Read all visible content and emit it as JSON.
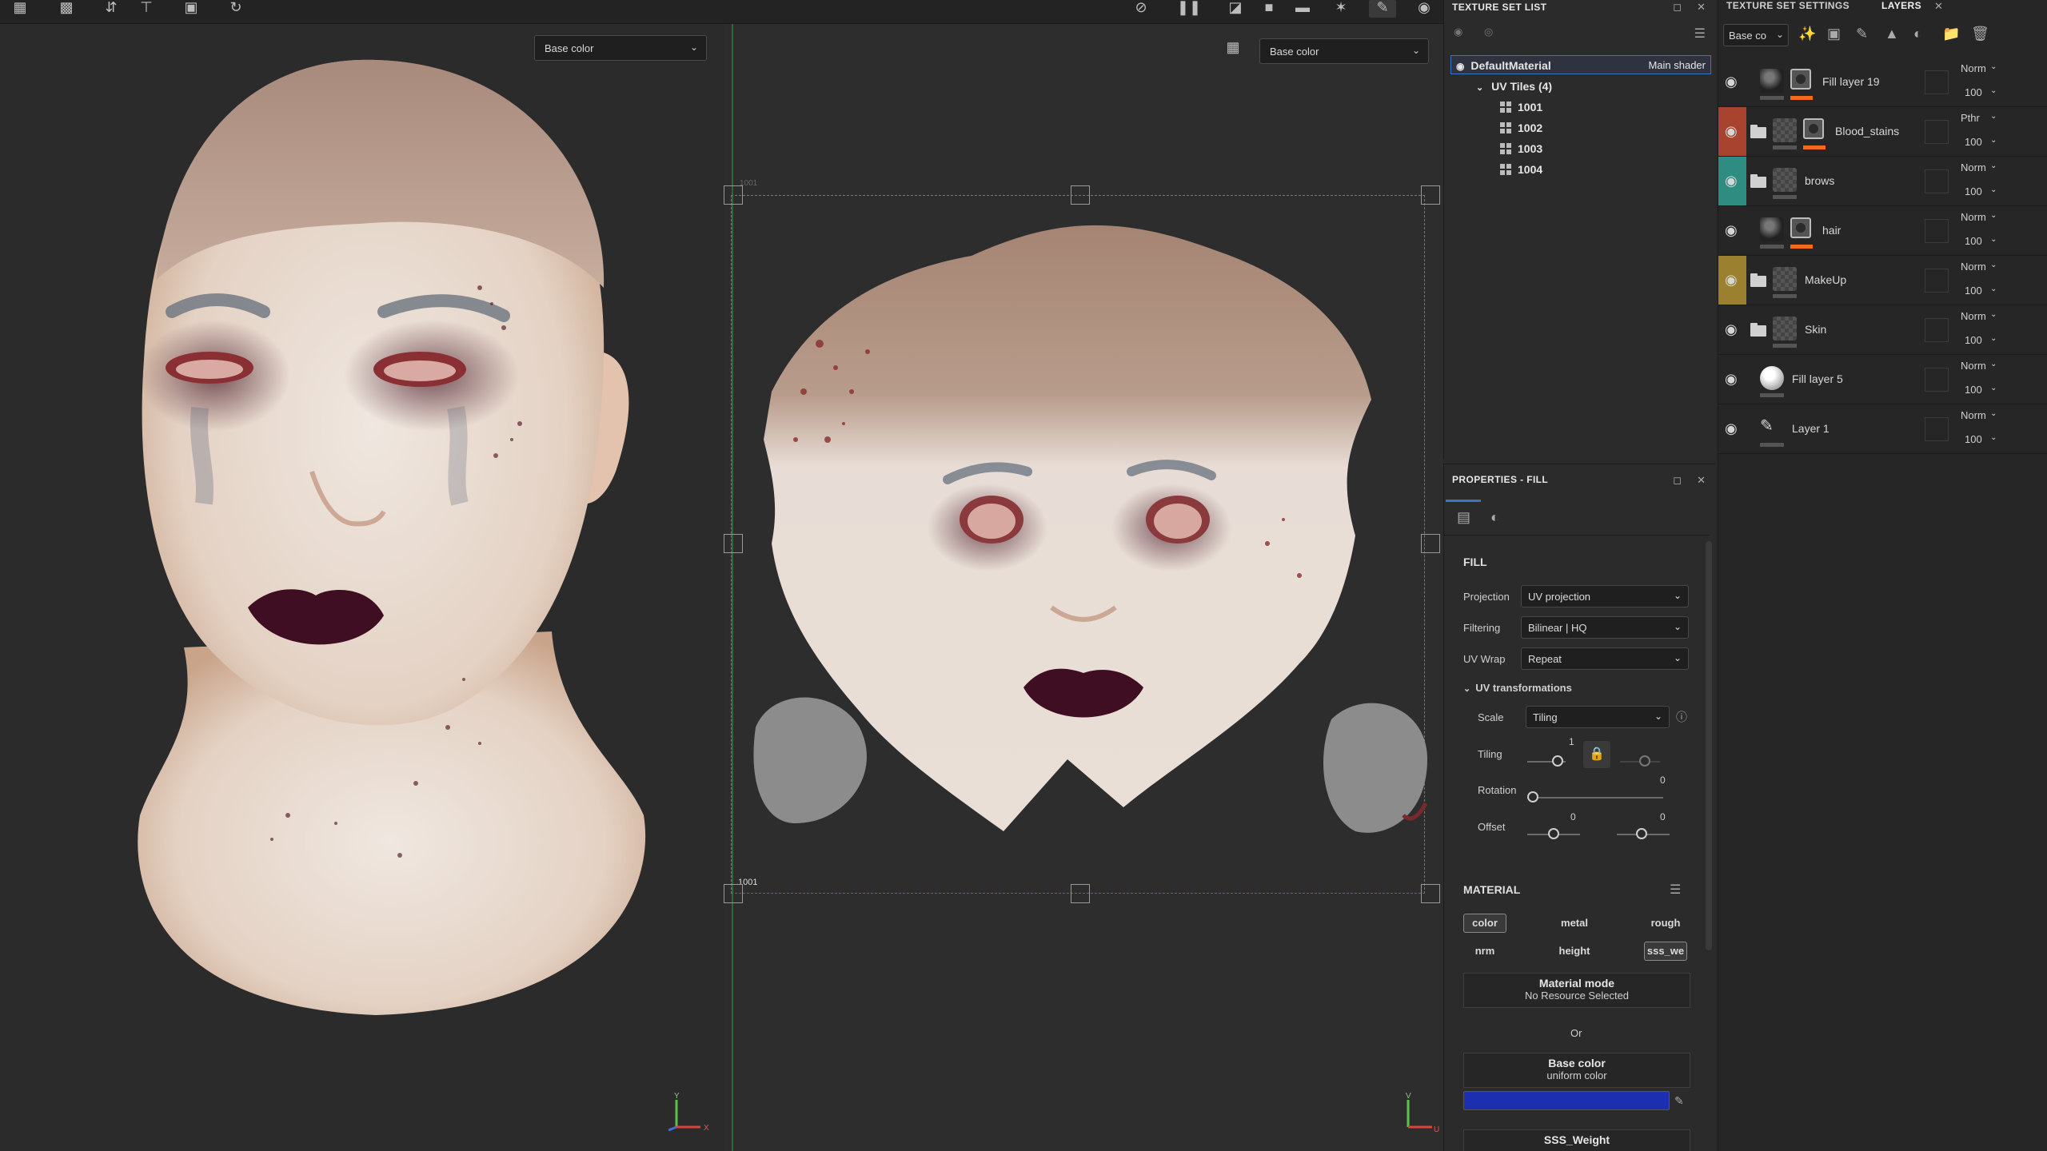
{
  "viewports": {
    "left_channel_select": "Base color",
    "right_channel_select": "Base color",
    "uv_tile_tag_top": "1001",
    "uv_tile_tag_bottom": "1001",
    "axis_y": "Y",
    "axis_x": "X",
    "axis_v": "V",
    "axis_u": "U"
  },
  "texture_set_list": {
    "title": "TEXTURE SET LIST",
    "material_name": "DefaultMaterial",
    "shader": "Main shader",
    "uv_tiles_label": "UV Tiles (4)",
    "tiles": [
      "1001",
      "1002",
      "1003",
      "1004"
    ]
  },
  "properties": {
    "title": "PROPERTIES - FILL",
    "fill_title": "FILL",
    "projection_label": "Projection",
    "projection_value": "UV projection",
    "filtering_label": "Filtering",
    "filtering_value": "Bilinear | HQ",
    "uvwrap_label": "UV Wrap",
    "uvwrap_value": "Repeat",
    "uvtrans_label": "UV transformations",
    "scale_label": "Scale",
    "scale_value": "Tiling",
    "tiling_label": "Tiling",
    "tiling_value": "1",
    "rotation_label": "Rotation",
    "rotation_value": "0",
    "offset_label": "Offset",
    "offset_u": "0",
    "offset_v": "0",
    "material_title": "MATERIAL",
    "channels": [
      "color",
      "metal",
      "rough",
      "nrm",
      "height",
      "sss_we"
    ],
    "material_mode_title": "Material mode",
    "material_mode_value": "No Resource Selected",
    "or_label": "Or",
    "base_color_title": "Base color",
    "base_color_sub": "uniform color",
    "base_color_hex": "#1c2fb0",
    "sss_title": "SSS_Weight"
  },
  "layers_panel": {
    "tab_settings": "TEXTURE SET SETTINGS",
    "tab_layers": "LAYERS",
    "channel_select": "Base co",
    "layers": [
      {
        "name": "Fill layer 19",
        "blend": "Norm",
        "opacity": "100",
        "color": ""
      },
      {
        "name": "Blood_stains",
        "blend": "Pthr",
        "opacity": "100",
        "color": "#a8432f"
      },
      {
        "name": "brows",
        "blend": "Norm",
        "opacity": "100",
        "color": "#2e8c80"
      },
      {
        "name": "hair",
        "blend": "Norm",
        "opacity": "100",
        "color": ""
      },
      {
        "name": "MakeUp",
        "blend": "Norm",
        "opacity": "100",
        "color": "#9b8030"
      },
      {
        "name": "Skin",
        "blend": "Norm",
        "opacity": "100",
        "color": ""
      },
      {
        "name": "Fill layer 5",
        "blend": "Norm",
        "opacity": "100",
        "color": ""
      },
      {
        "name": "Layer 1",
        "blend": "Norm",
        "opacity": "100",
        "color": ""
      }
    ]
  }
}
